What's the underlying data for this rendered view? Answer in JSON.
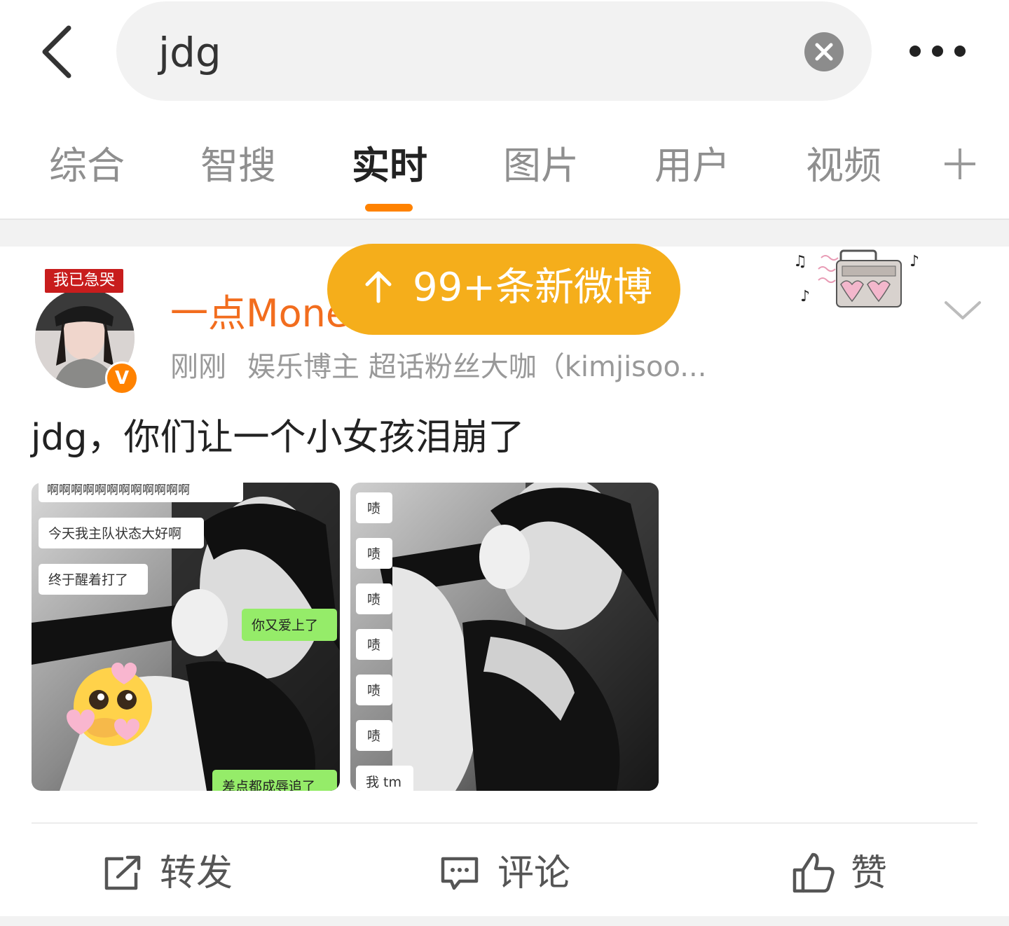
{
  "search": {
    "query": "jdg"
  },
  "tabs": [
    {
      "label": "综合"
    },
    {
      "label": "智搜"
    },
    {
      "label": "实时",
      "active": true
    },
    {
      "label": "图片"
    },
    {
      "label": "用户"
    },
    {
      "label": "视频"
    }
  ],
  "banner": {
    "new_posts": "99+条新微博"
  },
  "post": {
    "user_tag": "我已急哭",
    "username": "一点Mone",
    "verified_mark": "V",
    "time": "刚刚",
    "description": "娱乐博主 超话粉丝大咖（kimjisoo...",
    "text": "jdg，你们让一个小女孩泪崩了",
    "image1_bubbles": [
      "啊啊啊啊啊啊啊啊啊啊啊啊",
      "今天我主队状态大好啊",
      "终于醒着打了",
      "你又爱上了",
      "差点都成辱追了"
    ],
    "image2_bubbles": [
      "啧",
      "啧",
      "啧",
      "啧",
      "啧",
      "啧",
      "我 tm"
    ]
  },
  "actions": {
    "repost": "转发",
    "comment": "评论",
    "like": "赞"
  },
  "colors": {
    "accent": "#ff8200",
    "username": "#f26d1e",
    "banner": "#f5ae1b",
    "tag": "#c81d1d"
  }
}
